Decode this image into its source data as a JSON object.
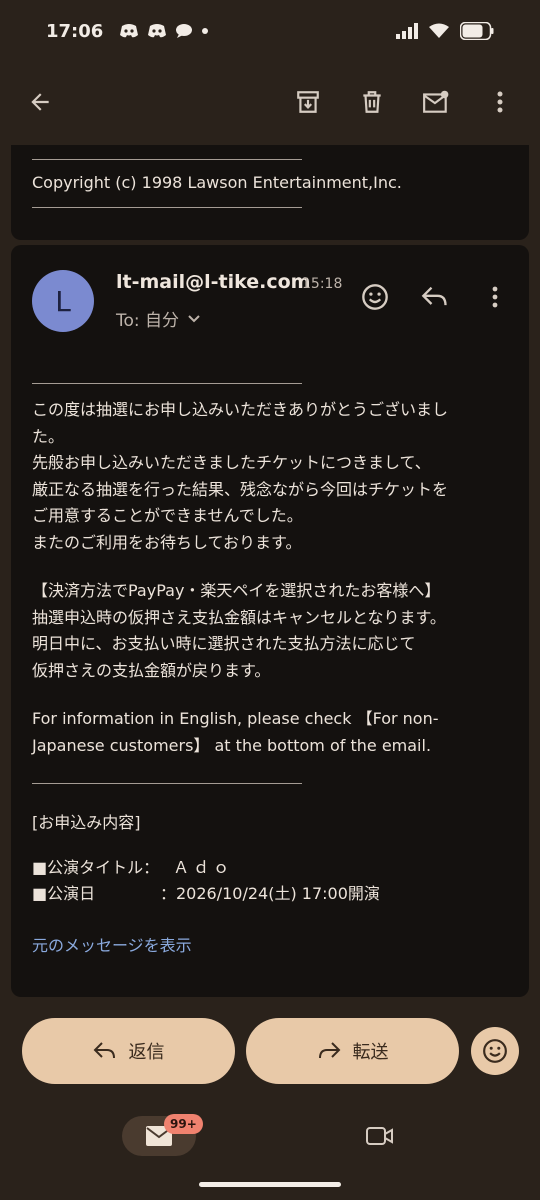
{
  "status_bar": {
    "time": "17:06"
  },
  "colors": {
    "accent": "#e8c9a8",
    "link": "#8aa9dd",
    "avatar": "#7b8ad0",
    "badge": "#f0826f"
  },
  "top_card": {
    "copyright": "Copyright (c) 1998 Lawson Entertainment,Inc."
  },
  "message": {
    "avatar_letter": "L",
    "sender": "lt-mail@l-tike.com",
    "time": "15:18",
    "to_label": "To: 自分",
    "body": {
      "p1": [
        "この度は抽選にお申し込みいただきありがとうございまし",
        "た。",
        "先般お申し込みいただきましたチケットにつきまして、",
        "厳正なる抽選を行った結果、残念ながら今回はチケットを",
        "ご用意することができませんでした。",
        "またのご利用をお待ちしております。"
      ],
      "p2": [
        "【決済方法でPayPay・楽天ペイを選択されたお客様へ】",
        "抽選申込時の仮押さえ支払金額はキャンセルとなります。",
        "明日中に、お支払い時に選択された支払方法に応じて",
        "仮押さえの支払金額が戻ります。"
      ],
      "p3": "For information in English, please check 【For non-Japanese customers】 at the bottom of the email.",
      "section_title": "[お申込み内容]",
      "details": [
        {
          "label": "■公演タイトル：",
          "value": "Ａｄｏ"
        },
        {
          "label": "■公演日",
          "value": "：2026/10/24(土) 17:00開演"
        }
      ]
    },
    "show_original": "元のメッセージを表示"
  },
  "actions": {
    "reply_label": "返信",
    "forward_label": "転送"
  },
  "nav": {
    "mail_badge": "99+"
  }
}
